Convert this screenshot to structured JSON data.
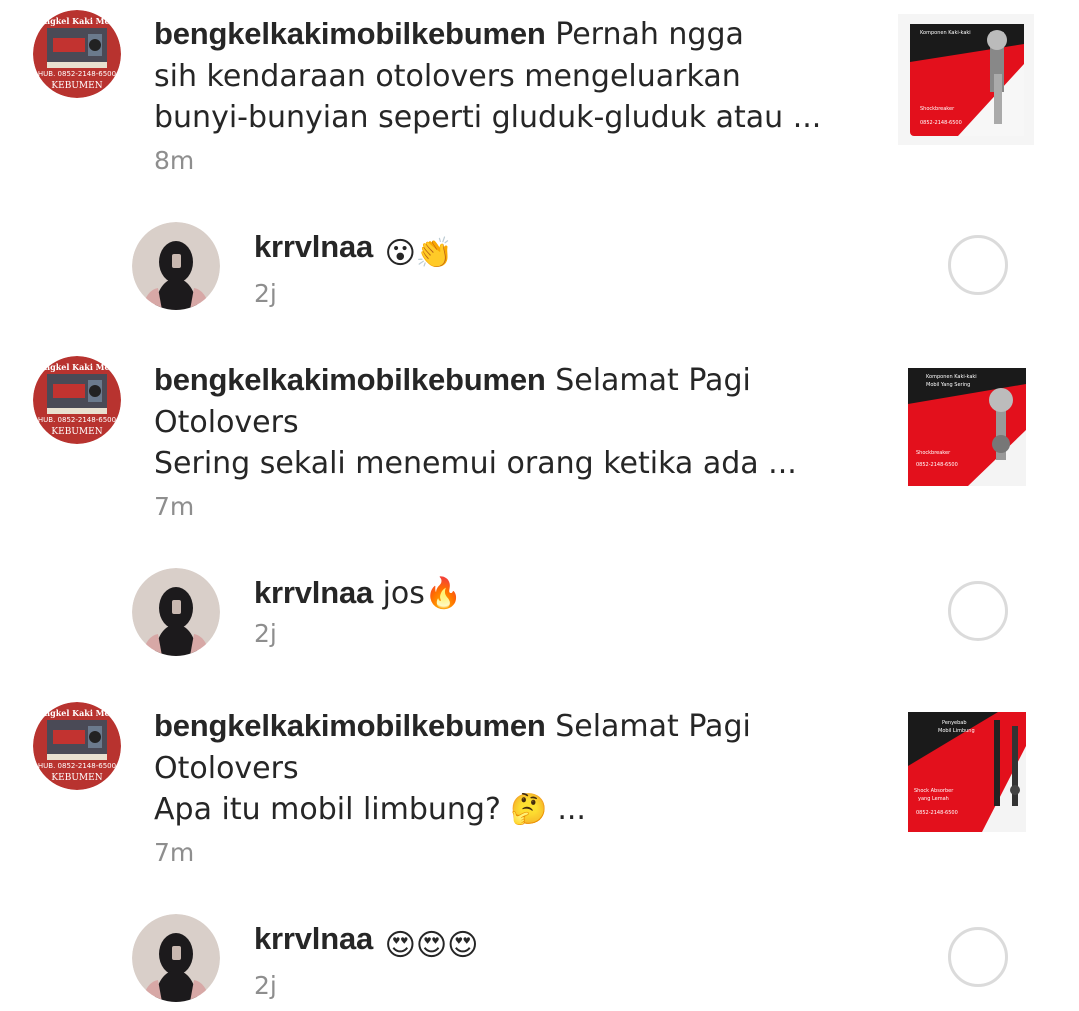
{
  "posts": [
    {
      "username": "bengkelkakimobilkebumen",
      "lines": [
        "Pernah ngga",
        "sih kendaraan otolovers mengeluarkan",
        "bunyi-bunyian seperti gluduk-gluduk atau ..."
      ],
      "time": "8m",
      "avatar": {
        "top_text": "Bengkel Kaki Mobil",
        "phone": "HUB. 0852-2148-6500",
        "city": "KEBUMEN"
      },
      "thumbnail": {
        "top_text": "Komponen Kaki-kaki Mobil",
        "product": "Shockbreaker",
        "phone": "0852-2148-6500"
      }
    },
    {
      "username": "bengkelkakimobilkebumen",
      "lines": [
        "Selamat Pagi",
        "Otolovers",
        "Sering sekali menemui orang ketika ada ..."
      ],
      "time": "7m",
      "avatar": {
        "top_text": "Bengkel Kaki Mobil",
        "phone": "HUB. 0852-2148-6500",
        "city": "KEBUMEN"
      },
      "thumbnail": {
        "top_text": "Komponen Kaki-kaki Mobil Yang Sering Bermasalah",
        "product": "Shockbreaker",
        "phone": "0852-2148-6500"
      }
    },
    {
      "username": "bengkelkakimobilkebumen",
      "lines": [
        "Selamat Pagi",
        "Otolovers",
        "Apa itu mobil limbung? 🤔 ..."
      ],
      "time": "7m",
      "avatar": {
        "top_text": "Bengkel Kaki Mobil",
        "phone": "HUB. 0852-2148-6500",
        "city": "KEBUMEN"
      },
      "thumbnail": {
        "top_text": "Penyebab Mobil Limbung",
        "product": "Shock Absorber yang Lemah",
        "phone": "0852-2148-6500"
      }
    }
  ],
  "replies": [
    {
      "username": "krrvlnaa",
      "text": "😮👏",
      "time": "2j"
    },
    {
      "username": "krrvlnaa",
      "text": "jos🔥",
      "time": "2j"
    },
    {
      "username": "krrvlnaa",
      "text": "😍😍😍",
      "time": "2j"
    }
  ],
  "colors": {
    "brand_red": "#e3101c",
    "avatar_red": "#b8332f",
    "text": "#262626",
    "meta": "#8e8e8e",
    "circle_border": "#dbdbdb"
  }
}
